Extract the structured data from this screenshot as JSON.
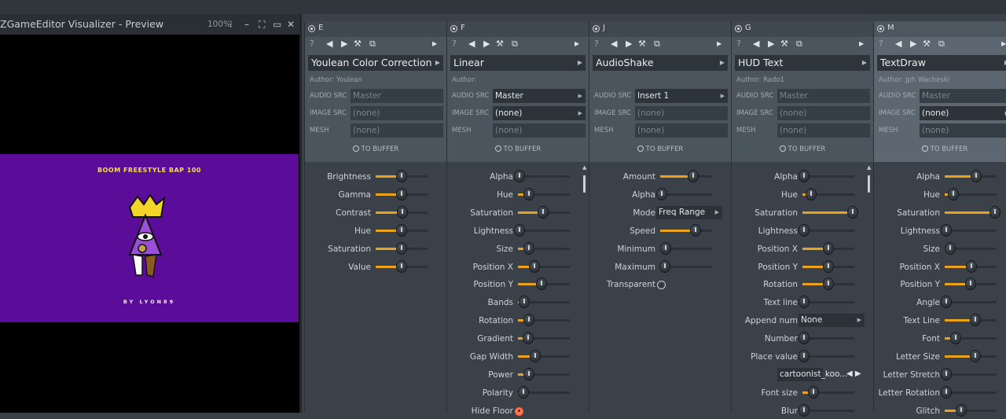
{
  "preview": {
    "title": "ZGameEditor Visualizer - Preview",
    "zoom": "100%",
    "artwork_title": "BOOM FREESTYLE BAP 100",
    "artwork_credit": "BY LYON89",
    "background_color": "#5b0d99"
  },
  "columns": [
    {
      "letter": "E",
      "name": "Youlean Color Correction",
      "author": "Author: Youlean",
      "audio_src": "Master",
      "audio_active": false,
      "image_src": "(none)",
      "image_active": false,
      "mesh": "(none)",
      "to_buffer": "TO BUFFER",
      "params": [
        {
          "label": "Brightness",
          "type": "slider",
          "value": 0.5
        },
        {
          "label": "Gamma",
          "type": "slider",
          "value": 0.5
        },
        {
          "label": "Contrast",
          "type": "slider",
          "value": 0.52
        },
        {
          "label": "Hue",
          "type": "slider",
          "value": 0.5
        },
        {
          "label": "Saturation",
          "type": "slider",
          "value": 0.5
        },
        {
          "label": "Value",
          "type": "slider",
          "value": 0.5
        }
      ]
    },
    {
      "letter": "F",
      "name": "Linear",
      "author": "Author:",
      "audio_src": "Master",
      "audio_active": true,
      "image_src": "(none)",
      "image_active": true,
      "mesh": "(none)",
      "to_buffer": "TO BUFFER",
      "params": [
        {
          "label": "Alpha",
          "type": "slider",
          "value": 0.0
        },
        {
          "label": "Hue",
          "type": "slider",
          "value": 0.2
        },
        {
          "label": "Saturation",
          "type": "slider",
          "value": 0.48
        },
        {
          "label": "Lightness",
          "type": "slider",
          "value": 0.0
        },
        {
          "label": "Size",
          "type": "slider",
          "value": 0.2
        },
        {
          "label": "Position X",
          "type": "slider",
          "value": 0.3
        },
        {
          "label": "Position Y",
          "type": "slider",
          "value": 0.45
        },
        {
          "label": "Bands",
          "type": "slider",
          "value": 0.1
        },
        {
          "label": "Rotation",
          "type": "slider",
          "value": 0.2
        },
        {
          "label": "Gradient",
          "type": "slider",
          "value": 0.18
        },
        {
          "label": "Gap Width",
          "type": "slider",
          "value": 0.32
        },
        {
          "label": "Power",
          "type": "slider",
          "value": 0.2
        },
        {
          "label": "Polarity",
          "type": "slider",
          "value": 0.08
        },
        {
          "label": "Hide Floor",
          "type": "toggle",
          "on": true
        }
      ]
    },
    {
      "letter": "J",
      "name": "AudioShake",
      "author": "",
      "audio_src": "Insert 1",
      "audio_active": true,
      "image_src": "(none)",
      "image_active": false,
      "mesh": "(none)",
      "to_buffer": "TO BUFFER",
      "params": [
        {
          "label": "Amount",
          "type": "slider",
          "value": 0.64
        },
        {
          "label": "Alpha",
          "type": "slider",
          "value": 0.0
        },
        {
          "label": "Mode",
          "type": "dropdown",
          "value": "Freq Range"
        },
        {
          "label": "Speed",
          "type": "slider",
          "value": 0.7
        },
        {
          "label": "Minimum",
          "type": "slider",
          "value": 0.08
        },
        {
          "label": "Maximum",
          "type": "slider",
          "value": 0.06
        },
        {
          "label": "Transparent",
          "type": "toggle",
          "on": false
        }
      ]
    },
    {
      "letter": "G",
      "name": "HUD Text",
      "author": "Author: Rado1",
      "audio_src": "Master",
      "audio_active": false,
      "image_src": "(none)",
      "image_active": false,
      "mesh": "(none)",
      "to_buffer": "TO BUFFER",
      "params": [
        {
          "label": "Alpha",
          "type": "slider",
          "value": 0.0
        },
        {
          "label": "Hue",
          "type": "slider",
          "value": 0.15
        },
        {
          "label": "Saturation",
          "type": "slider",
          "value": 1.0
        },
        {
          "label": "Lightness",
          "type": "slider",
          "value": 0.0
        },
        {
          "label": "Position X",
          "type": "slider",
          "value": 0.5
        },
        {
          "label": "Position Y",
          "type": "slider",
          "value": 0.5
        },
        {
          "label": "Rotation",
          "type": "slider",
          "value": 0.5
        },
        {
          "label": "Text line",
          "type": "slider",
          "value": 0.0
        },
        {
          "label": "Append num",
          "type": "dropdown",
          "value": "None"
        },
        {
          "label": "Number",
          "type": "slider",
          "value": 0.0
        },
        {
          "label": "Place value",
          "type": "slider",
          "value": 0.0
        },
        {
          "label": "Font",
          "type": "font",
          "value": "cartoonist_koo..."
        },
        {
          "label": "Font size",
          "type": "slider",
          "value": 0.2
        },
        {
          "label": "Blur",
          "type": "slider",
          "value": 0.0
        }
      ]
    },
    {
      "letter": "M",
      "name": "TextDraw",
      "author": "Author: Jph Wacheski",
      "audio_src": "Master",
      "audio_active": false,
      "image_src": "(none)",
      "image_active": true,
      "mesh": "(none)",
      "to_buffer": "TO BUFFER",
      "params": [
        {
          "label": "Alpha",
          "type": "slider",
          "value": 0.62
        },
        {
          "label": "Hue",
          "type": "slider",
          "value": 0.15
        },
        {
          "label": "Saturation",
          "type": "slider",
          "value": 1.0
        },
        {
          "label": "Lightness",
          "type": "slider",
          "value": 0.0
        },
        {
          "label": "Size",
          "type": "slider",
          "value": 0.08
        },
        {
          "label": "Position X",
          "type": "slider",
          "value": 0.52
        },
        {
          "label": "Position Y",
          "type": "slider",
          "value": 0.5
        },
        {
          "label": "Angle",
          "type": "slider",
          "value": 0.0
        },
        {
          "label": "Text Line",
          "type": "slider",
          "value": 0.6
        },
        {
          "label": "Font",
          "type": "slider",
          "value": 0.2
        },
        {
          "label": "Letter Size",
          "type": "slider",
          "value": 0.6
        },
        {
          "label": "Letter Stretch",
          "type": "slider",
          "value": 0.0
        },
        {
          "label": "Letter Rotation",
          "type": "slider",
          "value": 0.0
        },
        {
          "label": "Glitch",
          "type": "slider",
          "value": 0.3
        }
      ]
    }
  ],
  "labels": {
    "audio_src": "AUDIO SRC",
    "image_src": "IMAGE SRC",
    "mesh": "MESH"
  },
  "accent_color": "#e9a21a"
}
